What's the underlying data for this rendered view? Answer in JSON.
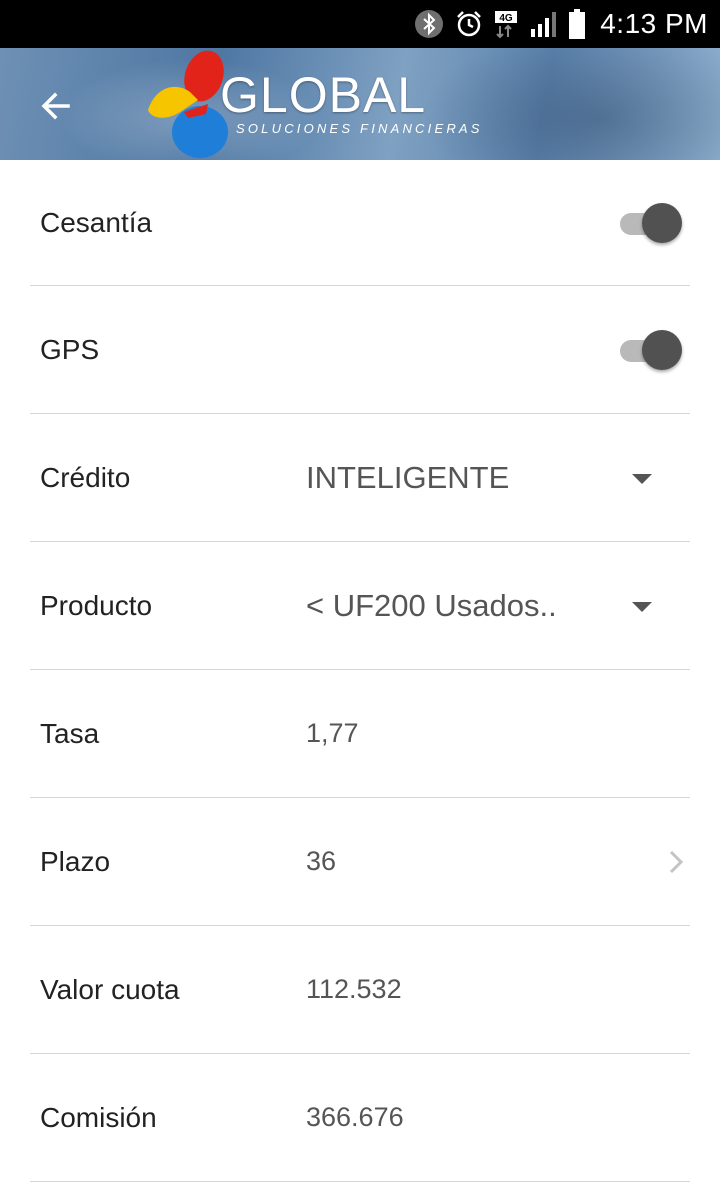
{
  "status_bar": {
    "time": "4:13 PM",
    "network": "4G",
    "icons": [
      "bluetooth-icon",
      "alarm-icon",
      "network-4g-icon",
      "signal-icon",
      "battery-icon"
    ]
  },
  "header": {
    "logo_text": "GLOBAL",
    "logo_subtitle": "SOLUCIONES FINANCIERAS",
    "back_icon": "arrow-left-icon"
  },
  "form": {
    "cesantia": {
      "label": "Cesantía",
      "enabled": true
    },
    "gps": {
      "label": "GPS",
      "enabled": true
    },
    "credito": {
      "label": "Crédito",
      "value": "INTELIGENTE"
    },
    "producto": {
      "label": "Producto",
      "value": "< UF200 Usados.."
    },
    "tasa": {
      "label": "Tasa",
      "value": "1,77"
    },
    "plazo": {
      "label": "Plazo",
      "value": "36"
    },
    "valor_cuota": {
      "label": "Valor cuota",
      "value": "112.532"
    },
    "comision": {
      "label": "Comisión",
      "value": "366.676"
    }
  },
  "colors": {
    "toggle_thumb": "#515151",
    "toggle_track": "#b9b9b9",
    "divider": "#d7d7d7",
    "logo_red": "#e2231a",
    "logo_yellow": "#f7c400",
    "logo_blue": "#1f7fd8"
  }
}
